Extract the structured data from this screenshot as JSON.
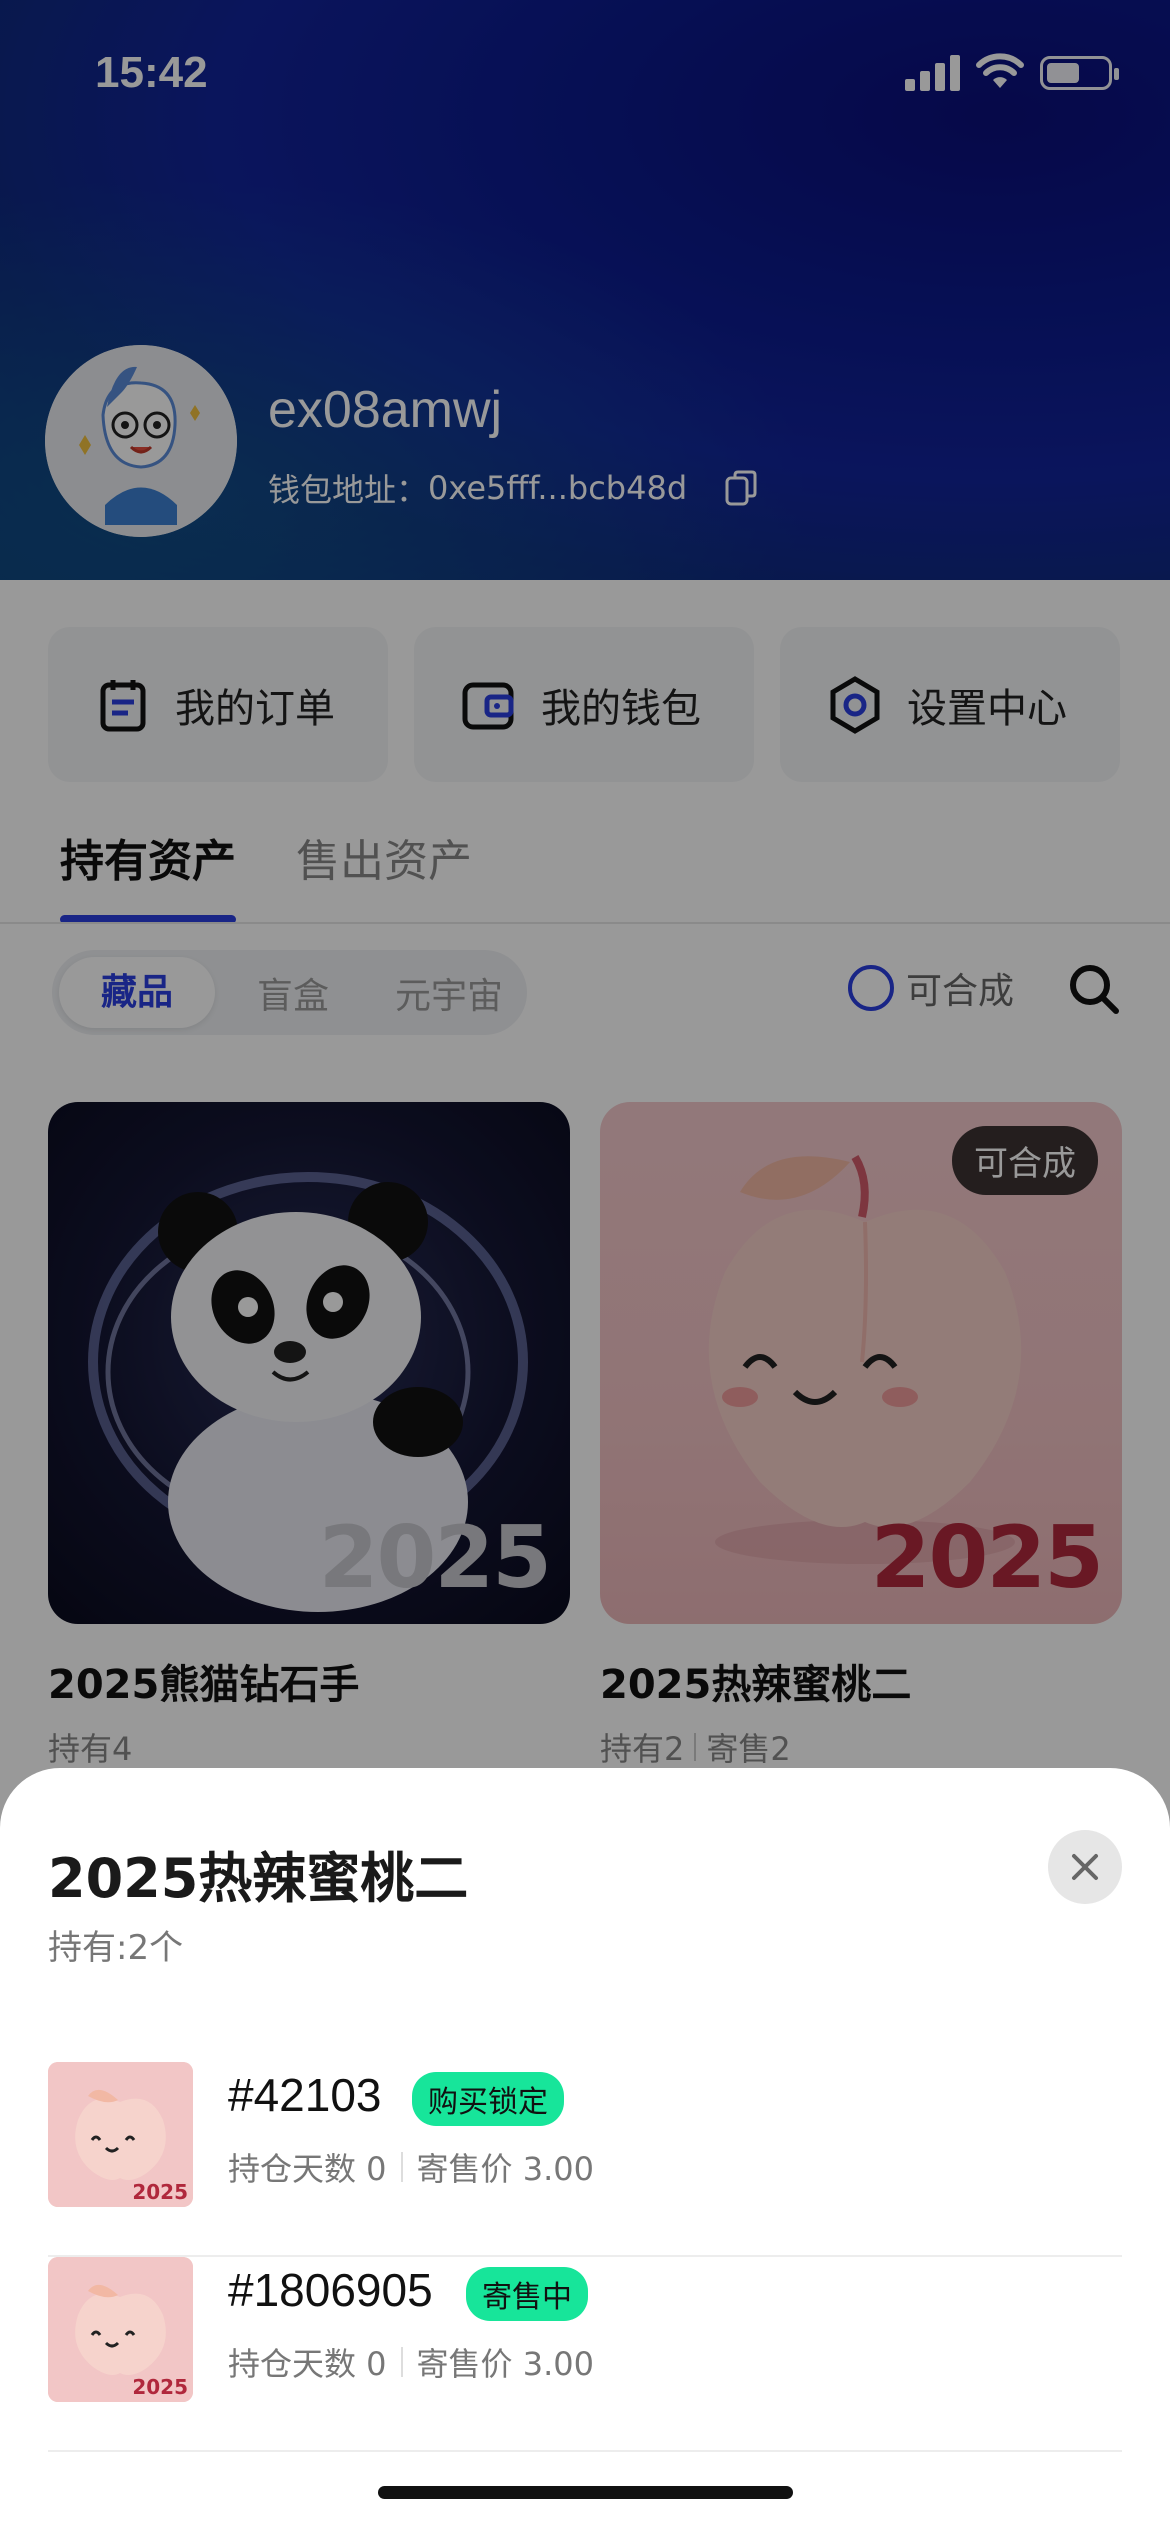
{
  "status": {
    "time": "15:42"
  },
  "profile": {
    "username": "ex08amwj",
    "wallet_label": "钱包地址：",
    "wallet_address": "0xe5fff...bcb48d"
  },
  "quick_actions": [
    {
      "label": "我的订单",
      "icon": "order-icon"
    },
    {
      "label": "我的钱包",
      "icon": "wallet-icon"
    },
    {
      "label": "设置中心",
      "icon": "settings-icon"
    }
  ],
  "tabs": {
    "active": "持有资产",
    "other": "售出资产"
  },
  "segments": {
    "items": [
      "藏品",
      "盲盒",
      "元宇宙"
    ],
    "selected": "藏品"
  },
  "filter": {
    "mergeable_label": "可合成"
  },
  "cards": [
    {
      "title": "2025熊猫钻石手",
      "held": "持有4",
      "year": "2025"
    },
    {
      "title": "2025热辣蜜桃二",
      "held": "持有2",
      "consign": "寄售2",
      "badge": "可合成",
      "year": "2025"
    }
  ],
  "sheet": {
    "title": "2025热辣蜜桃二",
    "subtitle": "持有:2个",
    "items": [
      {
        "id": "#42103",
        "status": "购买锁定",
        "days": "持仓天数 0",
        "price": "寄售价 3.00",
        "year": "2025"
      },
      {
        "id": "#1806905",
        "status": "寄售中",
        "days": "持仓天数 0",
        "price": "寄售价 3.00",
        "year": "2025"
      }
    ]
  },
  "colors": {
    "accent": "#2b3fe0",
    "status_badge": "#17e59a"
  }
}
